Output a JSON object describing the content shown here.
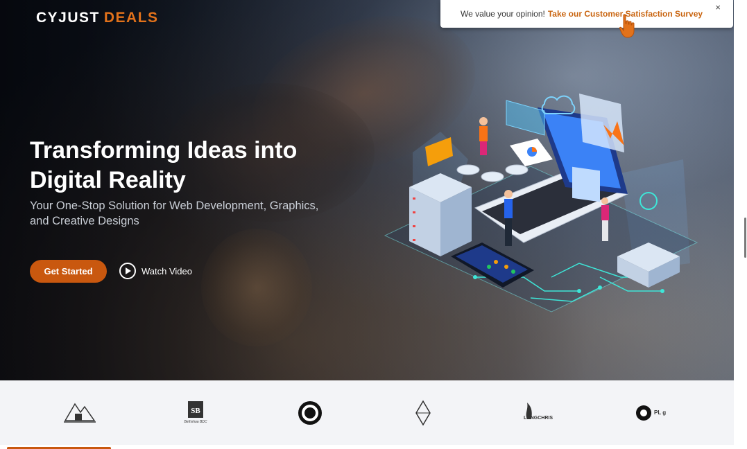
{
  "brand": {
    "name": "CYJUST",
    "accent": "DEALS"
  },
  "survey": {
    "message": "We value your opinion!",
    "link": "Take our Customer Satisfaction Survey",
    "close": "×"
  },
  "hero": {
    "title_line1": "Transforming Ideas into",
    "title_line2": "Digital Reality",
    "subtitle_line1": "Your One-Stop Solution for Web Development, Graphics,",
    "subtitle_line2": "and Creative Designs",
    "cta_label": "Get Started",
    "video_label": "Watch Video"
  },
  "logos": {
    "items": [
      {
        "icon": "mountain-building-logo"
      },
      {
        "icon": "sb-logo",
        "caption": "Bethshua BDC"
      },
      {
        "icon": "circle-emblem-logo"
      },
      {
        "icon": "diamond-logo"
      },
      {
        "icon": "flame-logo",
        "caption": "LONGCHRIS"
      },
      {
        "icon": "plug-logo",
        "caption": "PL g"
      }
    ]
  },
  "colors": {
    "accent": "#c9580f",
    "survey_link": "#c9640f",
    "logos_bg": "#f3f4f7"
  }
}
